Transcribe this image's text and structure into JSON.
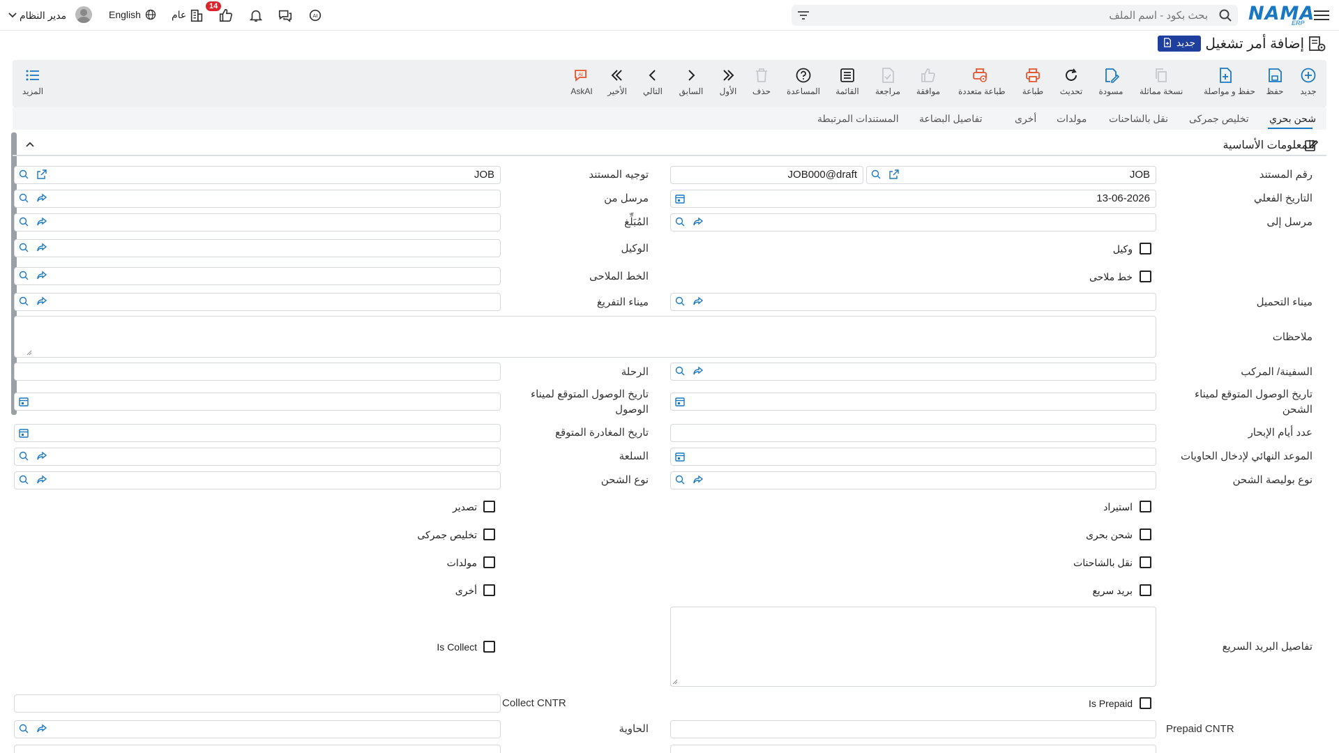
{
  "topbar": {
    "logo": "NAMA",
    "logo_sub": "ERP",
    "search_placeholder": "بحث بكود - اسم الملف",
    "notification_count": "14",
    "general_label": "عام",
    "language_label": "English",
    "user_name": "مدير النظام"
  },
  "page": {
    "title": "إضافة أمر تشغيل",
    "status_badge": "جديد"
  },
  "toolbar": {
    "new": "جديد",
    "save": "حفظ",
    "save_continue": "حفظ و مواصلة",
    "copy_similar": "نسخة مماثلة",
    "draft": "مسودة",
    "refresh": "تحديث",
    "print": "طباعة",
    "multi_print": "طباعة متعددة",
    "approve": "موافقة",
    "review": "مراجعة",
    "list": "القائمة",
    "help": "المساعدة",
    "delete": "حذف",
    "first": "الأول",
    "previous": "السابق",
    "next": "التالي",
    "last": "الأخير",
    "askai": "AskAI",
    "more": "المزيد"
  },
  "tabs": [
    "شحن بحري",
    "تخليص جمركى",
    "نقل بالشاحنات",
    "مولدات",
    "أخرى",
    "تفاصيل البضاعة",
    "المستندات المرتبطة"
  ],
  "section": {
    "title": "المعلومات الأساسية"
  },
  "form": {
    "doc_number_label": "رقم المستند",
    "doc_number_prefix": "JOB",
    "doc_number_value": "JOB000@draft",
    "doc_direction_label": "توجيه المستند",
    "doc_direction_value": "JOB",
    "actual_date_label": "التاريخ الفعلي",
    "actual_date_value": "13-06-2026",
    "sent_from_label": "مرسل من",
    "sent_to_label": "مرسل إلى",
    "notifier_label": "المُبَلِّغ",
    "agent_check_label": "وكيل",
    "agent_label": "الوكيل",
    "shipping_line_check_label": "خط ملاحى",
    "shipping_line_label": "الخط الملاحى",
    "loading_port_label": "ميناء التحميل",
    "discharge_port_label": "ميناء التفريغ",
    "notes_label": "ملاحظات",
    "vessel_label": "السفينة/ المركب",
    "voyage_label": "الرحلة",
    "eta_loading_port_label": "تاريخ الوصول المتوقع لميناء الشحن",
    "eta_arrival_port_label": "تاريخ الوصول المتوقع لميناء الوصول",
    "sailing_days_label": "عدد أيام الإبحار",
    "etd_label": "تاريخ المغادرة المتوقع",
    "container_cutoff_label": "الموعد النهائي لإدخال الحاويات",
    "commodity_label": "السلعة",
    "bl_type_label": "نوع بوليصة الشحن",
    "shipment_type_label": "نوع الشحن",
    "import_label": "استيراد",
    "export_label": "تصدير",
    "sea_freight_label": "شحن بحرى",
    "customs_label": "تخليص جمركى",
    "trucking_label": "نقل بالشاحنات",
    "generators_label": "مولدات",
    "express_mail_label": "بريد سريع",
    "other_label": "أخرى",
    "express_details_label": "تفاصيل البريد السريع",
    "is_collect_label": "Is Collect",
    "is_prepaid_label": "Is Prepaid",
    "collect_cntr_label": "Collect CNTR",
    "prepaid_cntr_label": "Prepaid CNTR",
    "container_label": "الحاوية"
  },
  "colors": {
    "brand": "#1a78c2",
    "badge_red": "#d9262c",
    "new_badge": "#1f3f9e",
    "print_icon": "#e8542e"
  }
}
